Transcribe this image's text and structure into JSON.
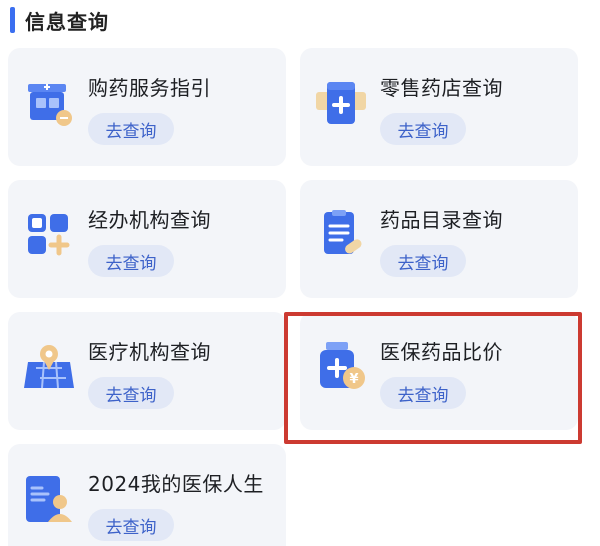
{
  "section": {
    "title": "信息查询"
  },
  "cards": [
    {
      "title": "购药服务指引",
      "button": "去查询",
      "icon": "pharmacy-store-icon"
    },
    {
      "title": "零售药店查询",
      "button": "去查询",
      "icon": "medical-kit-icon"
    },
    {
      "title": "经办机构查询",
      "button": "去查询",
      "icon": "grid-plus-icon"
    },
    {
      "title": "药品目录查询",
      "button": "去查询",
      "icon": "drug-catalog-icon"
    },
    {
      "title": "医疗机构查询",
      "button": "去查询",
      "icon": "location-map-icon"
    },
    {
      "title": "医保药品比价",
      "button": "去查询",
      "icon": "medicine-price-icon"
    },
    {
      "title": "2024我的医保人生",
      "button": "去查询",
      "icon": "profile-card-icon"
    }
  ],
  "colors": {
    "accent": "#3b6ff0",
    "button_bg": "#e2e8f6",
    "button_text": "#3d62c9",
    "card_bg": "#f3f5f9",
    "highlight": "#cc3a31"
  }
}
